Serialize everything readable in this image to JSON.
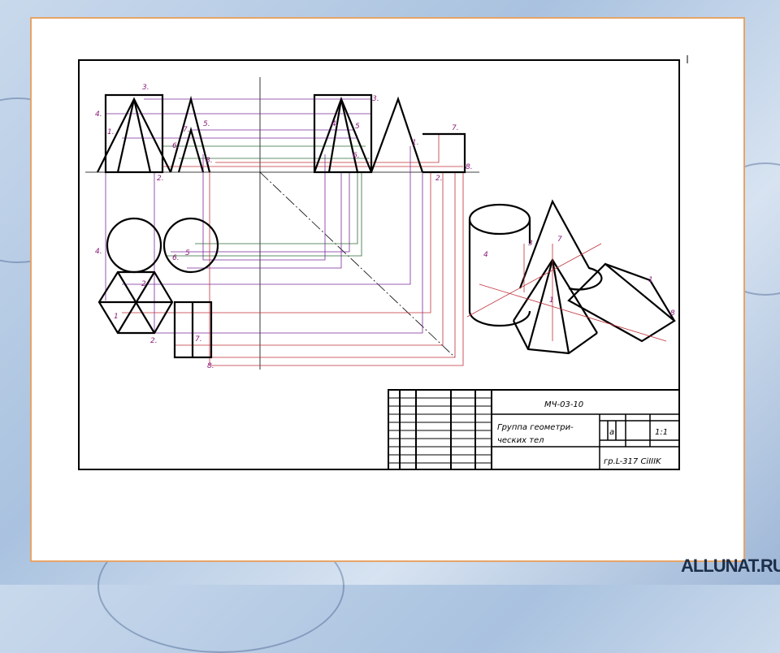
{
  "drawing": {
    "title_block": {
      "code": "МЧ-03-10",
      "title_line1": "Группа геометри-",
      "title_line2": "ческих тел",
      "scale": "1:1",
      "group": "гр.L-317 CiIIIK",
      "sheet_mark": "a"
    },
    "point_labels": {
      "p3": "3.",
      "p4": "4.",
      "p1": "1.",
      "p2": "2.",
      "p5": "5.",
      "p6": "6.",
      "p7": "7.",
      "p8": "8.",
      "p3b": "3.",
      "p4b": "4.",
      "p5b": "5",
      "p6b": "6.",
      "p7b": "7.",
      "p8b": "8.",
      "p1b": "1.",
      "p2b": "2.",
      "p4c": "4.",
      "p5c": "5",
      "p6c": "6.",
      "p1c": "1",
      "p2c": "2",
      "p2d": "2.",
      "p7c": "7.",
      "p8c": "8.",
      "iso4": "4",
      "iso3": "3",
      "iso7": "7",
      "iso1": "1",
      "iso1b": "1",
      "iso8": "8"
    },
    "colors": {
      "purple": "#7a2a9a",
      "green": "#2f6a3a",
      "red": "#c0303a",
      "frame": "#000000",
      "border": "#e6a468"
    }
  },
  "watermark": "ALLUNAT.RU"
}
